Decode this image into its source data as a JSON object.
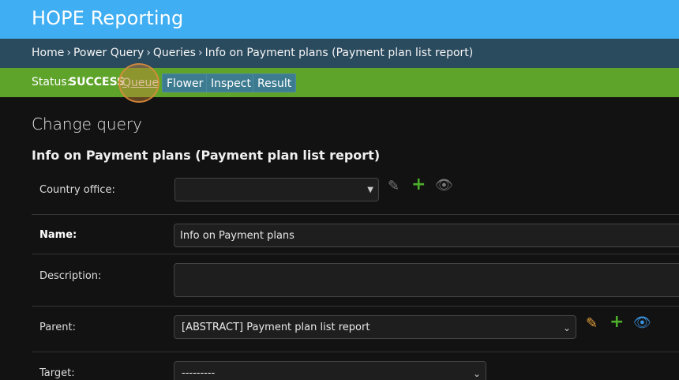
{
  "header": {
    "title": "HOPE Reporting"
  },
  "breadcrumbs": {
    "items": [
      "Home",
      "Power Query",
      "Queries",
      "Info on Payment plans (Payment plan list report)"
    ],
    "separator": "›"
  },
  "status_bar": {
    "label": "Status:",
    "value": "SUCCESS",
    "buttons": [
      "Queue",
      "Flower",
      "Inspect",
      "Result"
    ]
  },
  "content": {
    "page_title": "Change query",
    "object_title": "Info on Payment plans (Payment plan list report)"
  },
  "form": {
    "country_office": {
      "label": "Country office:",
      "value": ""
    },
    "name": {
      "label": "Name:",
      "value": "Info on Payment plans"
    },
    "description": {
      "label": "Description:",
      "value": ""
    },
    "parent": {
      "label": "Parent:",
      "value": "[ABSTRACT] Payment plan list report"
    },
    "target": {
      "label": "Target:",
      "value": "---------"
    }
  },
  "colors": {
    "header": "#3faef2",
    "breadcrumb_bar": "#2a4a5e",
    "status_bar": "#5ea42a",
    "edit_icon_active": "#e8a33d",
    "add_icon": "#4caf2a",
    "view_icon_active": "#3a8fd9",
    "icon_disabled": "#777777"
  },
  "icons": [
    "pencil-icon",
    "plus-icon",
    "eye-icon",
    "chevron-down-icon"
  ]
}
